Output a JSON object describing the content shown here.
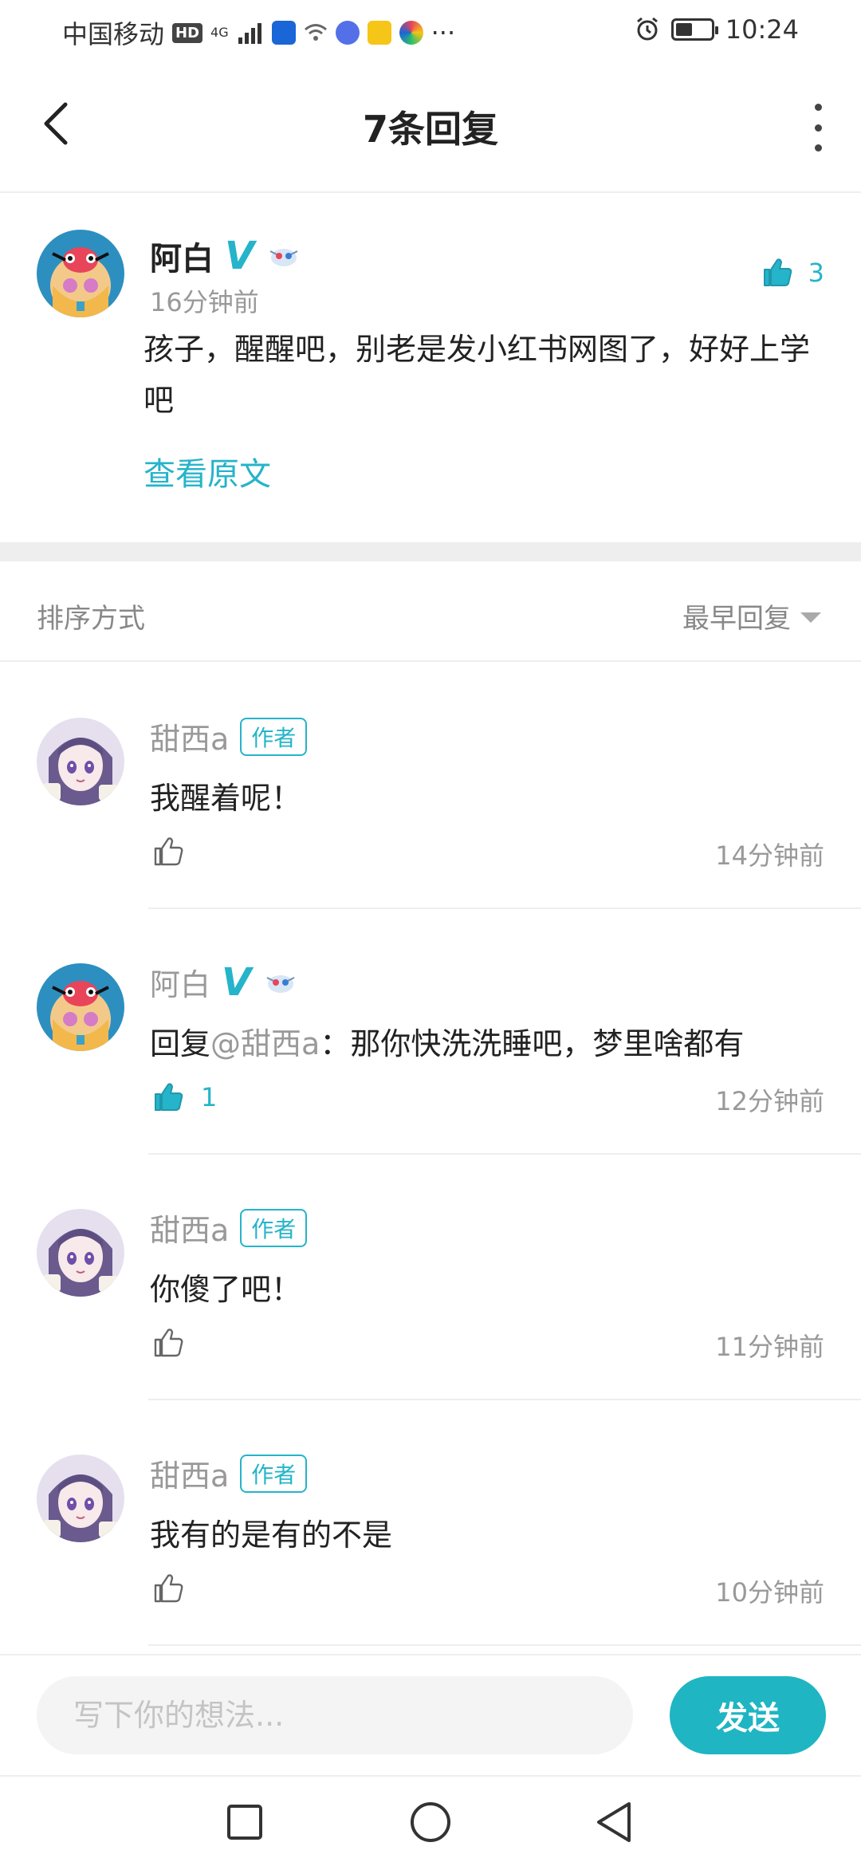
{
  "status_bar": {
    "carrier": "中国移动",
    "hd": "HD",
    "network": "4G",
    "more": "···",
    "time": "10:24",
    "icons": [
      "hd-icon",
      "signal-icon",
      "app-icon",
      "wifi-icon",
      "music-icon",
      "weibo-icon",
      "app2-icon",
      "more-icon",
      "alarm-icon",
      "battery-icon"
    ]
  },
  "header": {
    "title": "7条回复",
    "back_icon": "chevron-left-icon",
    "more_icon": "more-vertical-icon"
  },
  "main_comment": {
    "name": "阿白",
    "verified": "V",
    "time": "16分钟前",
    "likes": "3",
    "text": "孩子，醒醒吧，别老是发小红书网图了，好好上学吧",
    "view_original": "查看原文"
  },
  "sort": {
    "label": "排序方式",
    "value": "最早回复"
  },
  "replies": [
    {
      "name": "甜西a",
      "tag": "作者",
      "text": "我醒着呢！",
      "likes": "",
      "time": "14分钟前"
    },
    {
      "name": "阿白",
      "verified": "V",
      "reply_prefix": "回复",
      "mention": "@甜西a",
      "text": "：那你快洗洗睡吧，梦里啥都有",
      "likes": "1",
      "time": "12分钟前"
    },
    {
      "name": "甜西a",
      "tag": "作者",
      "text": "你傻了吧！",
      "likes": "",
      "time": "11分钟前"
    },
    {
      "name": "甜西a",
      "tag": "作者",
      "text": "我有的是有的不是",
      "likes": "",
      "time": "10分钟前"
    }
  ],
  "input": {
    "placeholder": "写下你的想法...",
    "send_label": "发送"
  },
  "colors": {
    "accent": "#25b4c9",
    "send_button": "#1fb5c3",
    "muted_text": "#999999",
    "divider": "#eeeeee"
  }
}
